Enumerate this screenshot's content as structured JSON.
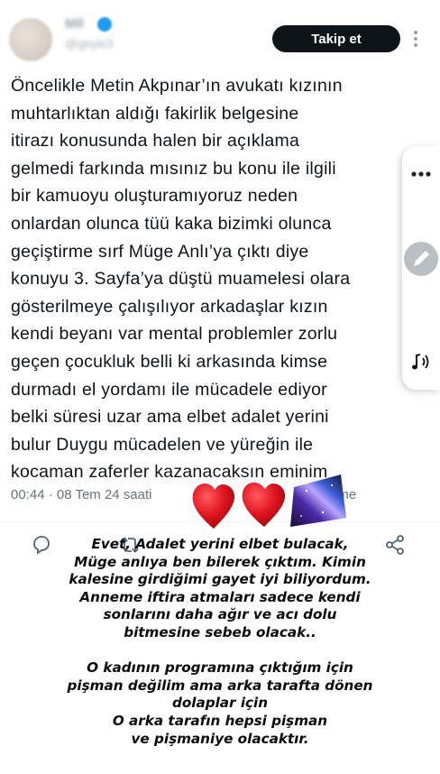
{
  "header": {
    "user_name": "Mll",
    "user_handle": "@gsyki3",
    "follow_label": "Takip et",
    "kebab_glyph": "⋮"
  },
  "tweet": {
    "lines": [
      "Öncelikle Metin Akpınar’ın avukatı kızının",
      "muhtarlıktan aldığı fakirlik belgesine",
      "itirazı konusunda halen bir açıklama",
      "gelmedi farkında mısınız bu konu ile ilgili",
      "bir kamuoyu oluşturamıyoruz neden",
      "onlardan olunca tüü kaka bizimki olunca",
      "geçiştirme sırf Müge Anlı’ya çıktı diye",
      "konuyu 3. Sayfa’ya düştü muamelesi olara",
      "gösterilmeye çalışılıyor arkadaşlar kızın",
      "kendi beyanı var mental problemler zorlu",
      "geçen çocukluk belli ki arkasında kimse",
      "durmadı el yordamı ile mücadele ediyor",
      "belki süresi uzar ama elbet adalet yerini",
      "bulur Duygu mücadelen ve yüreğin ile",
      "kocaman zaferler kazanacaksın eminim"
    ],
    "timestamp": "00:44 · 08 Tem 24 saati",
    "views_fragment": "eme"
  },
  "overlay": {
    "lines": [
      "Evet, Adalet yerini elbet bulacak,",
      "Müge anlıya ben bilerek çıktım. Kimin",
      "kalesine girdiğimi gayet iyi biliyordum.",
      "Anneme iftira atmaları sadece kendi",
      "sonlarını daha ağır ve acı dolu",
      "bitmesine sebeb olacak..",
      "",
      "O kadının programına çıktığım için",
      "pişman değilim ama arka tarafta dönen",
      "dolaplar için",
      "O arka tarafın hepsi pişman",
      "ve pişmaniye olacaktır."
    ]
  },
  "icons": {
    "avatar": "avatar",
    "verified": "verified-badge-icon",
    "side_more": "more-dots-icon",
    "side_edit": "pencil-icon",
    "side_music": "music-note-icon",
    "reply": "reply-icon",
    "retweet": "retweet-icon",
    "share": "share-icon",
    "stickers": [
      "red-heart-sticker",
      "red-heart-sticker",
      "galaxy-sticker"
    ]
  },
  "colors": {
    "follow_button": "#0f1419",
    "verified": "#1d9bf0",
    "meta_text": "#66737c",
    "heart": "#e0141e"
  }
}
